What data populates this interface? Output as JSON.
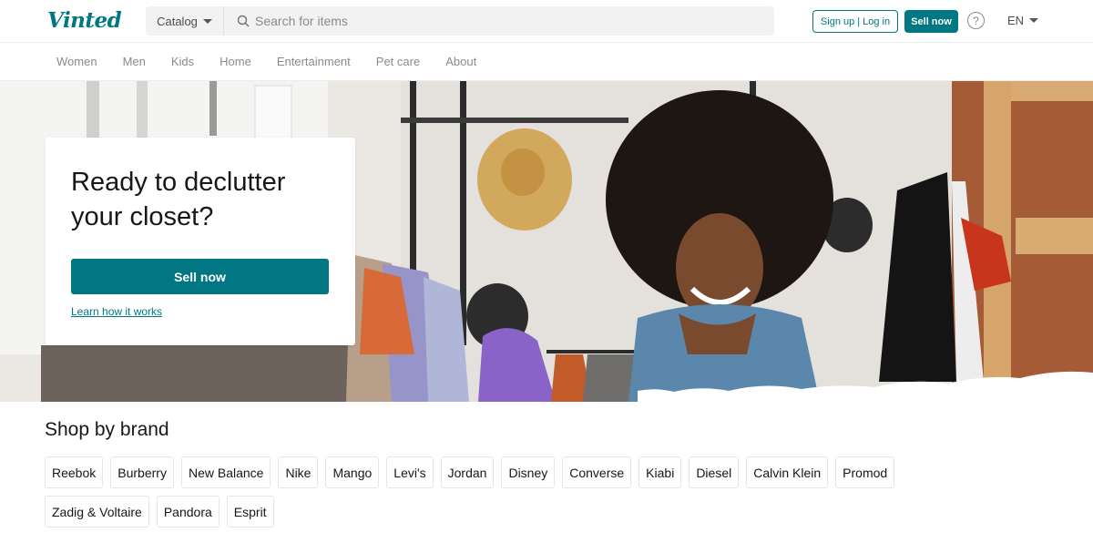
{
  "header": {
    "logo_text": "Vinted",
    "catalog_label": "Catalog",
    "search_placeholder": "Search for items",
    "signup_label": "Sign up",
    "separator": "|",
    "login_label": "Log in",
    "sell_label": "Sell now",
    "help_glyph": "?",
    "language": "EN"
  },
  "nav": {
    "items": [
      "Women",
      "Men",
      "Kids",
      "Home",
      "Entertainment",
      "Pet care",
      "About"
    ]
  },
  "hero": {
    "title": "Ready to declutter your closet?",
    "cta_label": "Sell now",
    "learn_link": "Learn how it works"
  },
  "brands": {
    "title": "Shop by brand",
    "row1": [
      "Reebok",
      "Burberry",
      "New Balance",
      "Nike",
      "Mango",
      "Levi's",
      "Jordan",
      "Disney",
      "Converse",
      "Kiabi",
      "Diesel",
      "Calvin Klein",
      "Promod"
    ],
    "row2": [
      "Zadig & Voltaire",
      "Pandora",
      "Esprit"
    ]
  },
  "colors": {
    "brand_teal": "#007782",
    "text_dark": "#171717",
    "nav_grey": "#8a8a8a"
  },
  "icons": {
    "search": "search-icon",
    "help": "help-icon",
    "dropdown": "chevron-down-icon"
  }
}
